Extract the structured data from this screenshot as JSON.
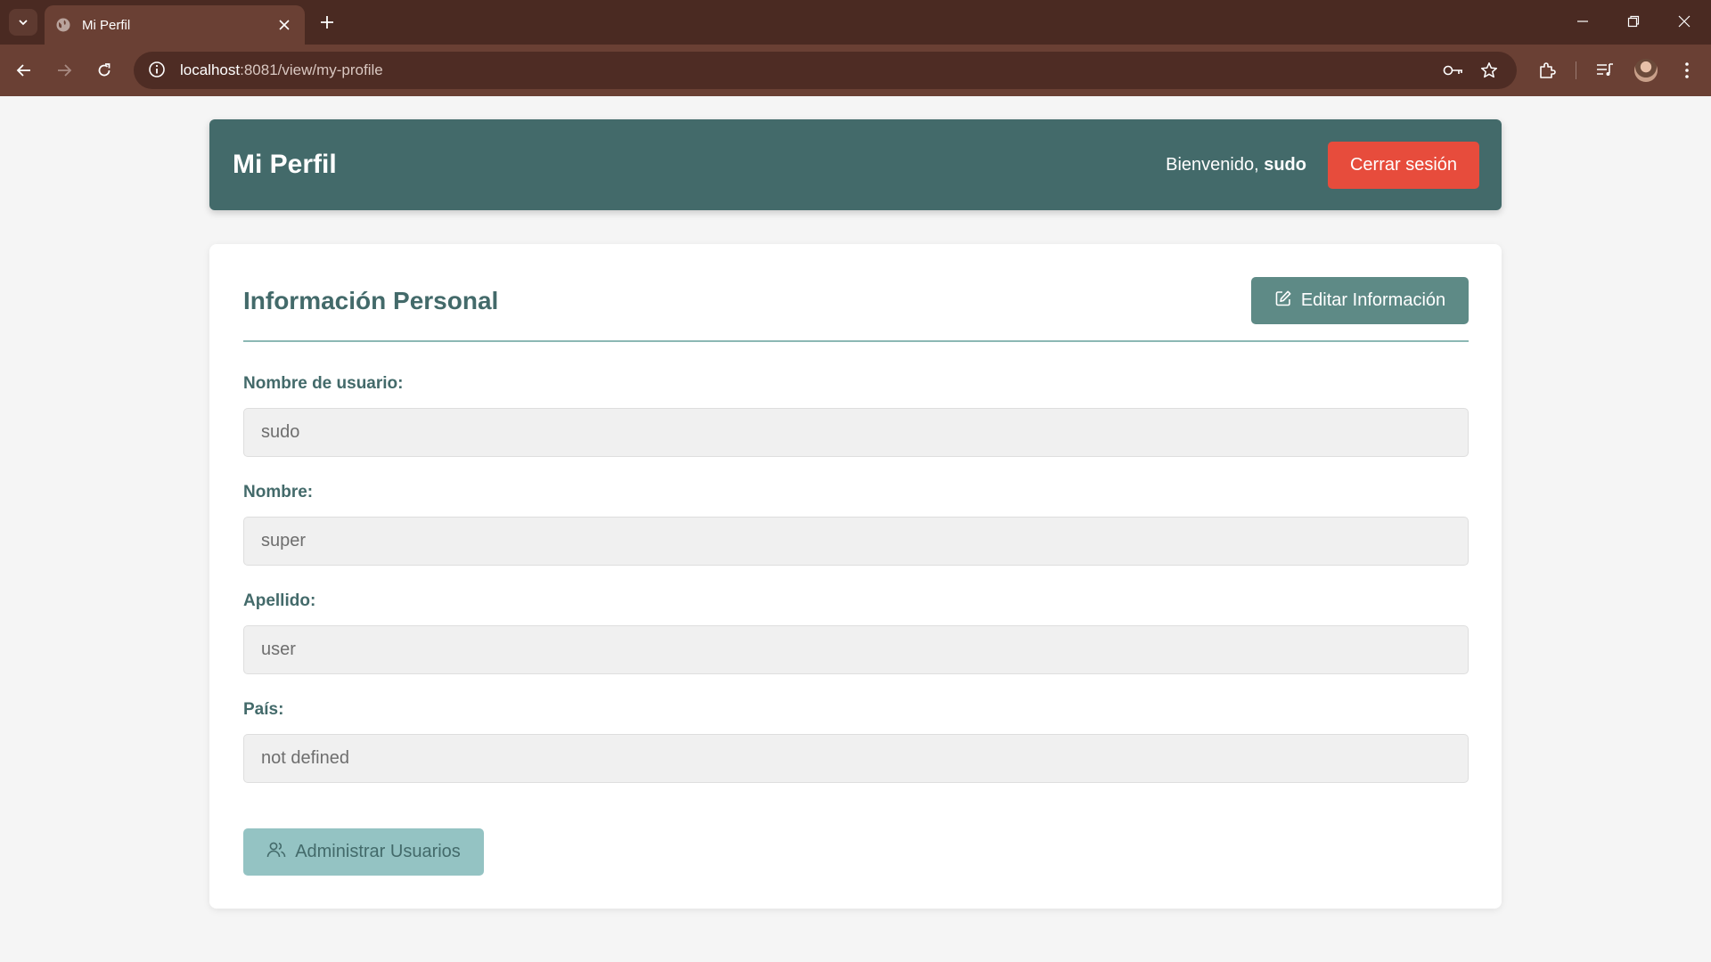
{
  "browser": {
    "tab_title": "Mi Perfil",
    "url_host": "localhost",
    "url_rest": ":8081/view/my-profile",
    "icons": [
      "tab-list-icon",
      "globe-icon",
      "close-icon",
      "plus-icon",
      "minimize-icon",
      "restore-icon",
      "window-close-icon",
      "back-icon",
      "forward-icon",
      "reload-icon",
      "info-icon",
      "key-icon",
      "star-icon",
      "extensions-icon",
      "media-icon",
      "menu-icon"
    ]
  },
  "header": {
    "title": "Mi Perfil",
    "welcome_prefix": "Bienvenido, ",
    "username": "sudo",
    "logout_label": "Cerrar sesión"
  },
  "profile": {
    "section_title": "Información Personal",
    "edit_label": "Editar Información",
    "fields": [
      {
        "label": "Nombre de usuario:",
        "value": "sudo"
      },
      {
        "label": "Nombre:",
        "value": "super"
      },
      {
        "label": "Apellido:",
        "value": "user"
      },
      {
        "label": "País:",
        "value": "not defined"
      }
    ],
    "admin_label": "Administrar Usuarios"
  },
  "colors": {
    "header_bg": "#436a6a",
    "logout_bg": "#e74c3c",
    "edit_bg": "#5e8a86",
    "admin_bg": "#94c3c3",
    "browser_frame": "#4a2a22"
  }
}
